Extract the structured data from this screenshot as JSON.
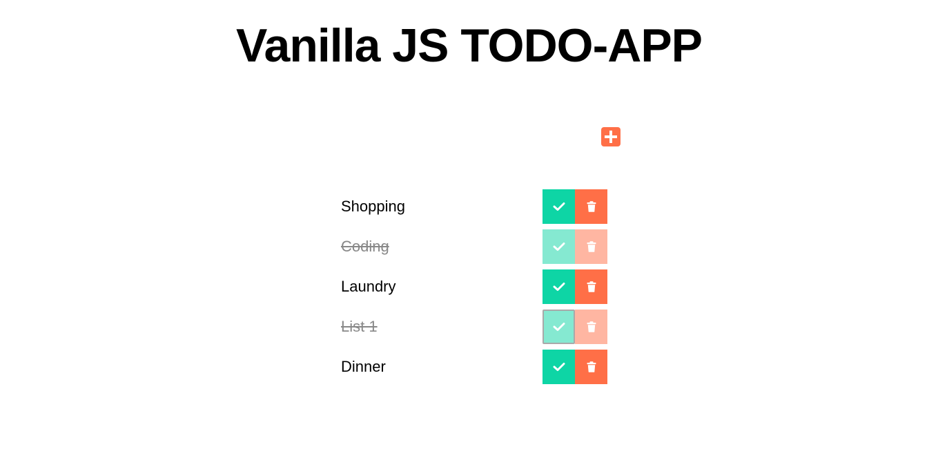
{
  "header": {
    "title": "Vanilla JS TODO-APP"
  },
  "form": {
    "input_value": "",
    "add_icon": "plus-square-icon"
  },
  "todos": [
    {
      "text": "Shopping",
      "completed": false
    },
    {
      "text": "Coding",
      "completed": true
    },
    {
      "text": "Laundry",
      "completed": false
    },
    {
      "text": "List 1",
      "completed": true
    },
    {
      "text": "Dinner",
      "completed": false
    }
  ],
  "icons": {
    "complete": "check-icon",
    "delete": "trash-icon"
  },
  "colors": {
    "complete": "#0ed5a5",
    "delete": "#ff6f47",
    "accent": "#ff6f47"
  }
}
